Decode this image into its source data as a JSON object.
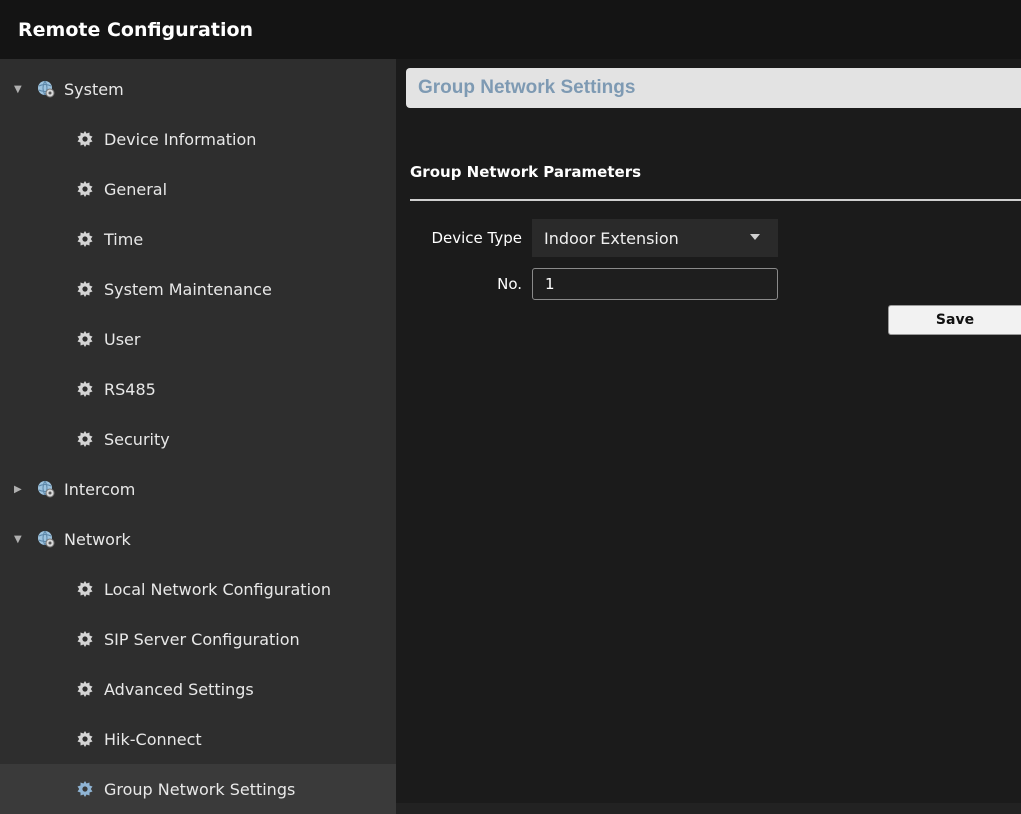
{
  "window": {
    "title": "Remote Configuration"
  },
  "sidebar": {
    "items": [
      {
        "label": "System",
        "type": "group",
        "expanded": true
      },
      {
        "label": "Device Information",
        "type": "child"
      },
      {
        "label": "General",
        "type": "child"
      },
      {
        "label": "Time",
        "type": "child"
      },
      {
        "label": "System Maintenance",
        "type": "child"
      },
      {
        "label": "User",
        "type": "child"
      },
      {
        "label": "RS485",
        "type": "child"
      },
      {
        "label": "Security",
        "type": "child"
      },
      {
        "label": "Intercom",
        "type": "group",
        "expanded": false
      },
      {
        "label": "Network",
        "type": "group",
        "expanded": true
      },
      {
        "label": "Local Network Configuration",
        "type": "child"
      },
      {
        "label": "SIP Server Configuration",
        "type": "child"
      },
      {
        "label": "Advanced Settings",
        "type": "child"
      },
      {
        "label": "Hik-Connect",
        "type": "child"
      },
      {
        "label": "Group Network Settings",
        "type": "child",
        "selected": true
      }
    ]
  },
  "panel": {
    "title": "Group Network Settings",
    "section_title": "Group Network Parameters",
    "device_type_label": "Device Type",
    "device_type_value": "Indoor Extension",
    "no_label": "No.",
    "no_value": "1",
    "save_label": "Save"
  },
  "colors": {
    "header_text": "#7e9ab3",
    "sidebar_bg": "#2e2e2e",
    "main_bg": "#1b1b1b",
    "titlebar_bg": "#141414"
  }
}
